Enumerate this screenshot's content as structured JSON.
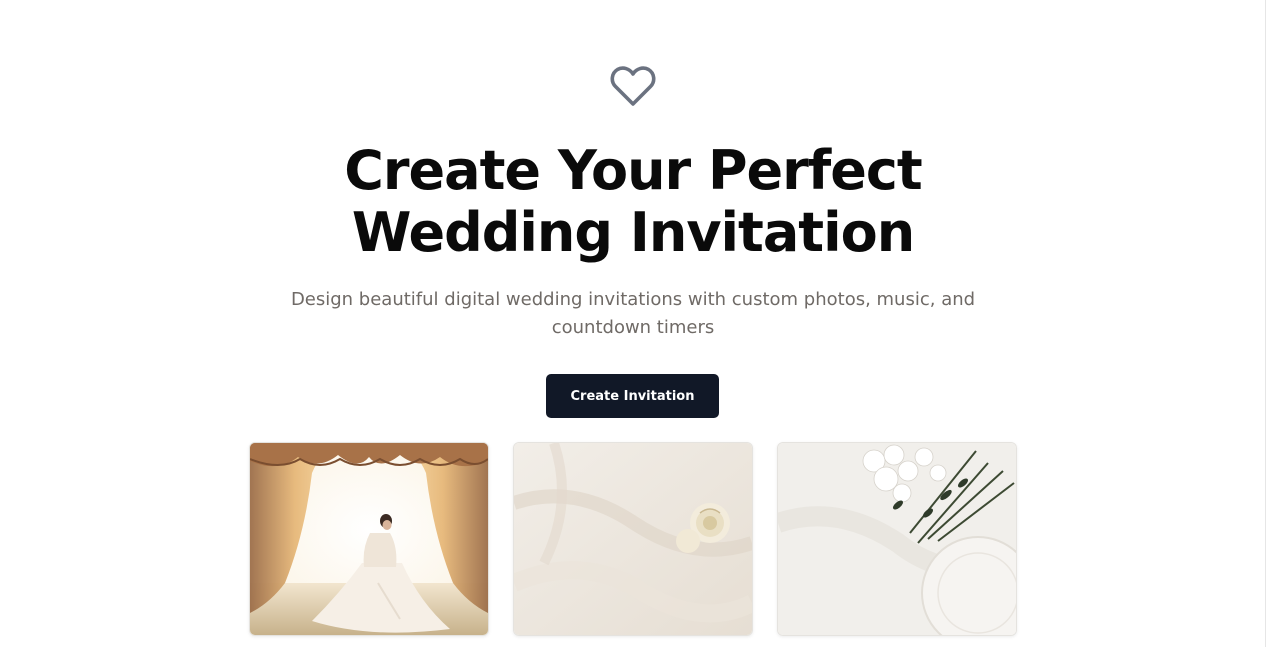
{
  "hero": {
    "icon": "heart-icon",
    "title": "Create Your Perfect Wedding Invitation",
    "subtitle": "Design beautiful digital wedding invitations with custom photos, music, and countdown timers",
    "cta_label": "Create Invitation"
  },
  "gallery": {
    "images": [
      {
        "icon": "bride-photo"
      },
      {
        "icon": "white-roses-on-fabric-photo"
      },
      {
        "icon": "flowers-and-plate-photo"
      }
    ]
  },
  "colors": {
    "title": "#0a0a0a",
    "subtitle": "#6f6a66",
    "button_bg": "#111827",
    "button_text": "#ffffff",
    "icon": "#6b7280"
  }
}
